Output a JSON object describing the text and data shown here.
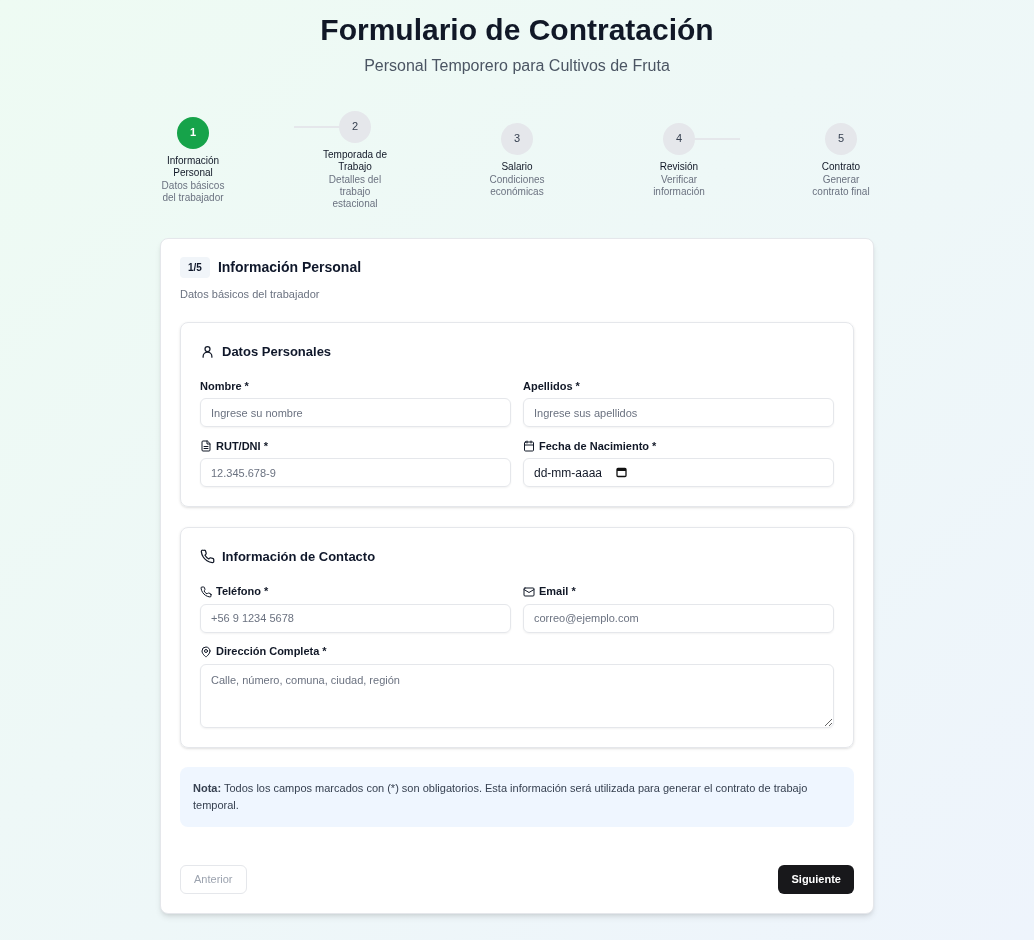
{
  "header": {
    "title": "Formulario de Contratación",
    "subtitle": "Personal Temporero para Cultivos de Fruta"
  },
  "steps": [
    {
      "number": "1",
      "title": "Información Personal",
      "description": "Datos básicos del trabajador",
      "selected": true
    },
    {
      "number": "2",
      "title": "Temporada de Trabajo",
      "description": "Detalles del trabajo estacional",
      "selected": false
    },
    {
      "number": "3",
      "title": "Salario",
      "description": "Condiciones económicas",
      "selected": false
    },
    {
      "number": "4",
      "title": "Revisión",
      "description": "Verificar información",
      "selected": false
    },
    {
      "number": "5",
      "title": "Contrato",
      "description": "Generar contrato final",
      "selected": false
    }
  ],
  "form": {
    "step_badge": "1/5",
    "title": "Información Personal",
    "description": "Datos básicos del trabajador",
    "sections": [
      {
        "title": "Datos Personales",
        "fields": [
          {
            "label": "Nombre *",
            "kind": "text",
            "placeholder": "Ingrese su nombre"
          },
          {
            "label": "Apellidos *",
            "kind": "text",
            "placeholder": "Ingrese sus apellidos"
          },
          {
            "label": "RUT/DNI *",
            "kind": "text",
            "placeholder": "12.345.678-9"
          },
          {
            "label": "Fecha de Nacimiento *",
            "kind": "date",
            "value": "dd-mm-aaaa"
          }
        ]
      },
      {
        "title": "Información de Contacto",
        "fields": [
          {
            "label": "Teléfono *",
            "kind": "text",
            "placeholder": "+56 9 1234 5678"
          },
          {
            "label": "Email *",
            "kind": "text",
            "placeholder": "correo@ejemplo.com"
          },
          {
            "label": "Dirección Completa *",
            "kind": "textarea",
            "placeholder": "Calle, número, comuna, ciudad, región"
          }
        ]
      }
    ],
    "note": "**Nota:** Todos los campos marcados con (*) son obligatorios. Esta información será utilizada para generar el contrato de trabajo temporal.",
    "buttons": {
      "previous": {
        "label": "Anterior",
        "disabled": true
      },
      "next": {
        "label": "Siguiente",
        "disabled": false
      }
    }
  }
}
